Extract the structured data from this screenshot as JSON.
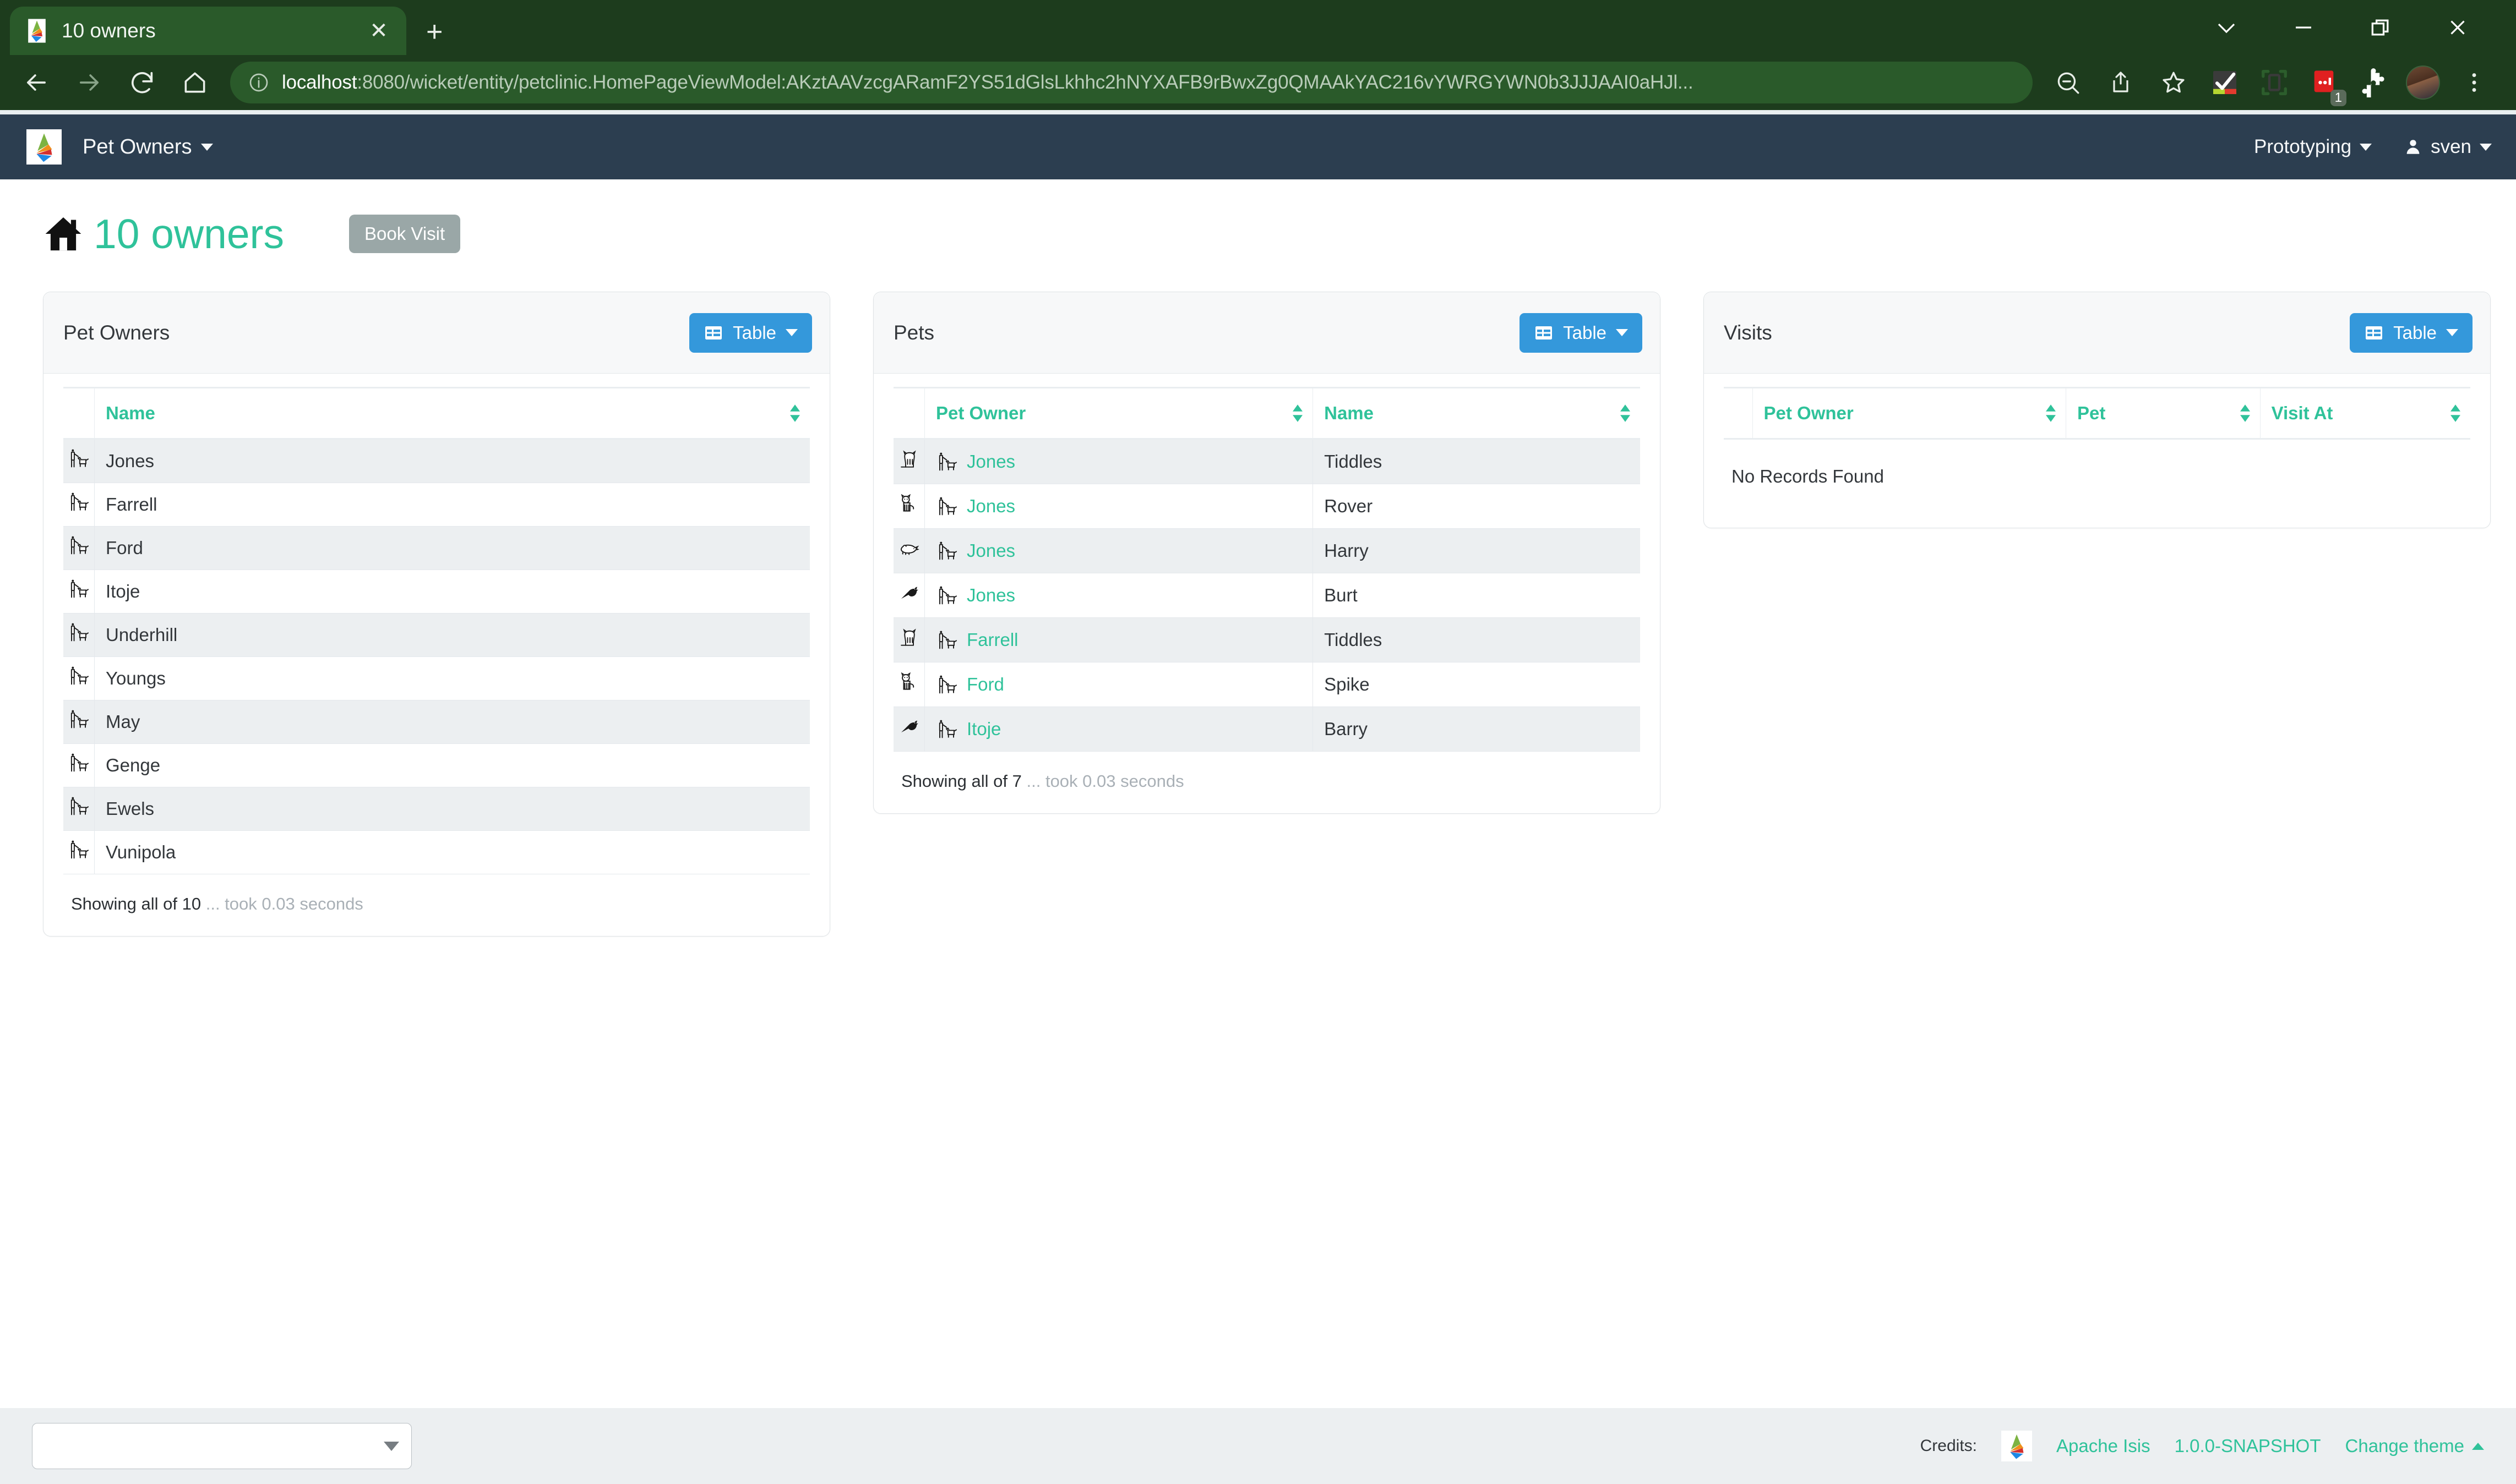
{
  "browser": {
    "tab": {
      "title": "10 owners",
      "favicon": "apache-isis-logo",
      "close": "✕"
    },
    "new_tab_label": "+",
    "window_controls": {
      "minimize_group": "chevron-down",
      "minimize": "—",
      "restore": "restore",
      "close": "✕"
    },
    "toolbar": {
      "back": "back-arrow",
      "forward": "forward-arrow",
      "reload": "reload",
      "home": "home",
      "url_scheme_host": "localhost",
      "url_rest": ":8080/wicket/entity/petclinic.HomePageViewModel:AKztAAVzcgARamF2YS51dGlsLkhhc2hNYXAFB9rBwxZg0QMAAkYAC216vYWRGYWN0b3JJJAAI0aHJl...",
      "zoom_out": "zoom-out-icon",
      "share": "share-icon",
      "bookmark": "star-icon",
      "extension_checkmark": "checkmark-extension-icon",
      "extension_tablet": "tablet-extension-icon",
      "extension_red_badge": "red-extension-icon",
      "extension_badge_count": "1",
      "extensions_puzzle": "puzzle-icon",
      "profile": "profile-avatar",
      "menu": "three-dot-menu-icon"
    }
  },
  "app": {
    "navbar": {
      "logo": "apache-isis-logo",
      "brand": "Pet Owners",
      "right_items": [
        {
          "label": "Prototyping",
          "icon": "none"
        },
        {
          "label": "sven",
          "icon": "user-icon"
        }
      ]
    },
    "header": {
      "home_icon": "home-icon",
      "title": "10 owners",
      "book_visit_label": "Book Visit"
    },
    "panels": [
      {
        "id": "pet-owners",
        "title": "Pet Owners",
        "view_button": "Table",
        "columns": [
          "Name"
        ],
        "rows": [
          {
            "icon": "person-walking-dog-icon",
            "name": "Jones"
          },
          {
            "icon": "person-walking-dog-icon",
            "name": "Farrell"
          },
          {
            "icon": "person-walking-dog-icon",
            "name": "Ford"
          },
          {
            "icon": "person-walking-dog-icon",
            "name": "Itoje"
          },
          {
            "icon": "person-walking-dog-icon",
            "name": "Underhill"
          },
          {
            "icon": "person-walking-dog-icon",
            "name": "Youngs"
          },
          {
            "icon": "person-walking-dog-icon",
            "name": "May"
          },
          {
            "icon": "person-walking-dog-icon",
            "name": "Genge"
          },
          {
            "icon": "person-walking-dog-icon",
            "name": "Ewels"
          },
          {
            "icon": "person-walking-dog-icon",
            "name": "Vunipola"
          }
        ],
        "showing": "Showing all of 10",
        "showing_muted": "... took 0.03 seconds"
      },
      {
        "id": "pets",
        "title": "Pets",
        "view_button": "Table",
        "columns": [
          "Pet Owner",
          "Name"
        ],
        "rows": [
          {
            "type_icon": "cat-icon",
            "owner": "Jones",
            "name": "Tiddles"
          },
          {
            "type_icon": "dog-icon",
            "owner": "Jones",
            "name": "Rover"
          },
          {
            "type_icon": "hamster-icon",
            "owner": "Jones",
            "name": "Harry"
          },
          {
            "type_icon": "bird-icon",
            "owner": "Jones",
            "name": "Burt"
          },
          {
            "type_icon": "cat-icon",
            "owner": "Farrell",
            "name": "Tiddles"
          },
          {
            "type_icon": "dog-icon",
            "owner": "Ford",
            "name": "Spike"
          },
          {
            "type_icon": "bird-icon",
            "owner": "Itoje",
            "name": "Barry"
          }
        ],
        "showing": "Showing all of 7",
        "showing_muted": "... took 0.03 seconds"
      },
      {
        "id": "visits",
        "title": "Visits",
        "view_button": "Table",
        "columns": [
          "Pet Owner",
          "Pet",
          "Visit At"
        ],
        "rows": [],
        "empty_message": "No Records Found"
      }
    ],
    "footer": {
      "theme_select_value": "",
      "credits_label": "Credits:",
      "logo": "apache-isis-logo",
      "project_link": "Apache Isis",
      "version": "1.0.0-SNAPSHOT",
      "change_theme": "Change theme"
    }
  },
  "colors": {
    "browser_chrome": "#1d3c1d",
    "navbar": "#2c3e50",
    "accent_teal": "#2fc29a",
    "button_blue": "#3498db",
    "button_grey": "#9aa7a7",
    "footer_bg": "#eceff1",
    "row_stripe": "#eceff1"
  }
}
